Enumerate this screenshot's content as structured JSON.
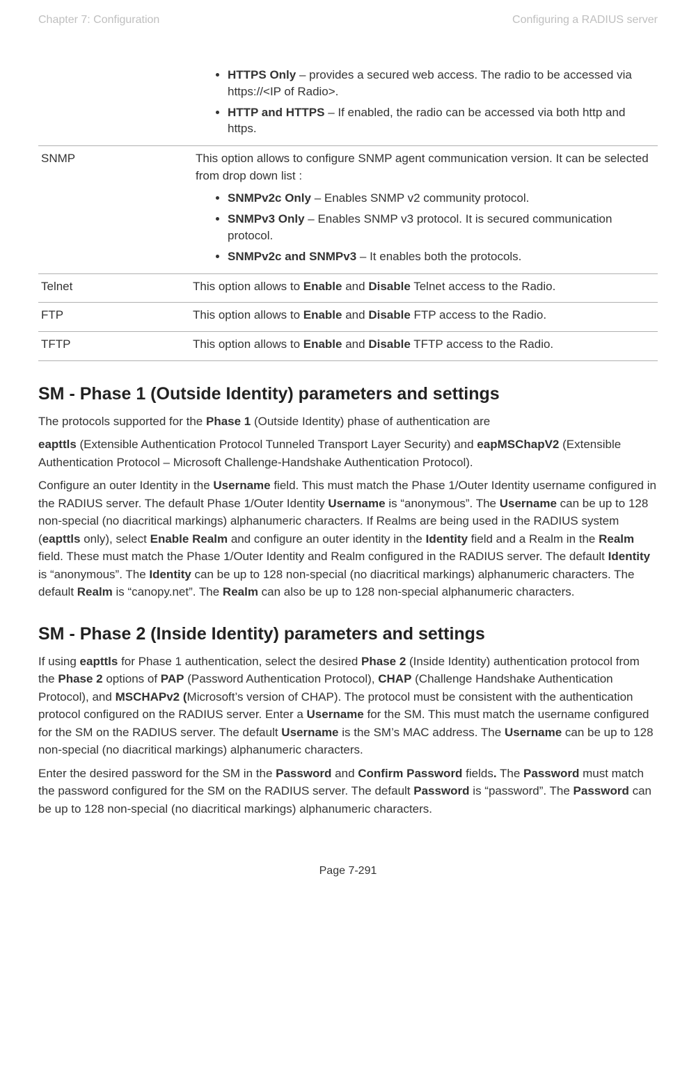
{
  "header": {
    "left": "Chapter 7:  Configuration",
    "right": "Configuring a RADIUS server"
  },
  "table": {
    "rows": [
      {
        "key": "",
        "intro": "",
        "bullets": [
          {
            "bold": "HTTPS Only",
            "text": " – provides a secured web access. The radio to be accessed via https://<IP of Radio>."
          },
          {
            "bold": "HTTP and HTTPS",
            "text": " – If enabled, the radio can be accessed via both http and https."
          }
        ]
      },
      {
        "key": "SNMP",
        "intro": "This option allows to configure SNMP agent communication version. It can be selected from drop down list :",
        "bullets": [
          {
            "bold": "SNMPv2c Only",
            "text": " – Enables SNMP v2 community protocol."
          },
          {
            "bold": "SNMPv3 Only",
            "text": " – Enables SNMP v3 protocol. It is secured communication protocol."
          },
          {
            "bold": "SNMPv2c and SNMPv3",
            "text": " – It enables both the protocols."
          }
        ]
      },
      {
        "key": "Telnet",
        "plain_pre": "This option allows to ",
        "plain_b1": "Enable",
        "plain_mid": " and ",
        "plain_b2": "Disable",
        "plain_post": " Telnet access to the Radio."
      },
      {
        "key": "FTP",
        "plain_pre": "This option allows to ",
        "plain_b1": "Enable",
        "plain_mid": " and ",
        "plain_b2": "Disable",
        "plain_post": " FTP access to the Radio."
      },
      {
        "key": "TFTP",
        "plain_pre": "This option allows to ",
        "plain_b1": "Enable",
        "plain_mid": " and ",
        "plain_b2": "Disable",
        "plain_post": " TFTP access to the Radio."
      }
    ]
  },
  "phase1": {
    "heading": "SM - Phase 1 (Outside Identity) parameters and settings",
    "p1_a": "The protocols supported for the ",
    "p1_b": "Phase 1",
    "p1_c": " (Outside Identity) phase of authentication are",
    "p2_a": "eapttls",
    "p2_b": " (Extensible Authentication Protocol Tunneled Transport Layer Security) and ",
    "p2_c": "eapMSChapV2",
    "p2_d": " (Extensible Authentication Protocol – Microsoft Challenge-Handshake Authentication Protocol).",
    "p3": {
      "t1": "Configure an outer Identity in the ",
      "b1": "Username",
      "t2": " field. This must match the Phase 1/Outer Identity username configured in the RADIUS server. The default Phase 1/Outer Identity ",
      "b2": "Username",
      "t3": " is “anonymous”. The ",
      "b3": "Username",
      "t4": " can be up to 128 non-special (no diacritical markings) alphanumeric characters. If Realms are being used in the RADIUS system (",
      "b4": "eapttls",
      "t5": " only), select ",
      "b5": "Enable Realm",
      "t6": " and configure an outer identity in the ",
      "b6": "Identity",
      "t7": " field and a Realm in the ",
      "b7": "Realm",
      "t8": " field. These must match the Phase 1/Outer Identity and Realm configured in the RADIUS server. The default ",
      "b8": "Identity",
      "t9": " is “anonymous”. The ",
      "b9": "Identity",
      "t10": " can be up to 128 non-special (no diacritical markings) alphanumeric characters. The default ",
      "b10": "Realm",
      "t11": " is “canopy.net”. The ",
      "b11": "Realm",
      "t12": " can also be up to 128 non-special alphanumeric characters."
    }
  },
  "phase2": {
    "heading": "SM - Phase 2 (Inside Identity) parameters and settings",
    "p1": {
      "t1": "If using ",
      "b1": "eapttls",
      "t2": " for Phase 1 authentication, select the desired ",
      "b2": "Phase 2",
      "t3": " (Inside Identity) authentication protocol from the ",
      "b3": "Phase 2",
      "t4": " options of ",
      "b4": "PAP",
      "t5": " (Password Authentication Protocol), ",
      "b5": "CHAP",
      "t6": " (Challenge Handshake Authentication Protocol), and ",
      "b6": "MSCHAPv2 (",
      "t7": "Microsoft’s version of CHAP). The protocol must be consistent with the authentication protocol configured on the RADIUS server. Enter a ",
      "b7": "Username",
      "t8": " for the SM. This must match the username configured for the SM on the RADIUS server. The default ",
      "b8": "Username",
      "t9": " is the SM’s MAC address. The ",
      "b9": "Username",
      "t10": " can be up to 128 non-special (no diacritical markings) alphanumeric characters."
    },
    "p2": {
      "t1": "Enter the desired password for the SM in the ",
      "b1": "Password",
      "t2": " and ",
      "b2": "Confirm Password",
      "t3": " fields",
      "b3": ".",
      "t4": " The ",
      "b4": "Password",
      "t5": " must match the password configured for the SM on the RADIUS server. The default ",
      "b5": "Password",
      "t6": " is “password”. The ",
      "b6": "Password",
      "t7": " can be up to 128 non-special (no diacritical markings) alphanumeric characters."
    }
  },
  "footer": "Page 7-291"
}
